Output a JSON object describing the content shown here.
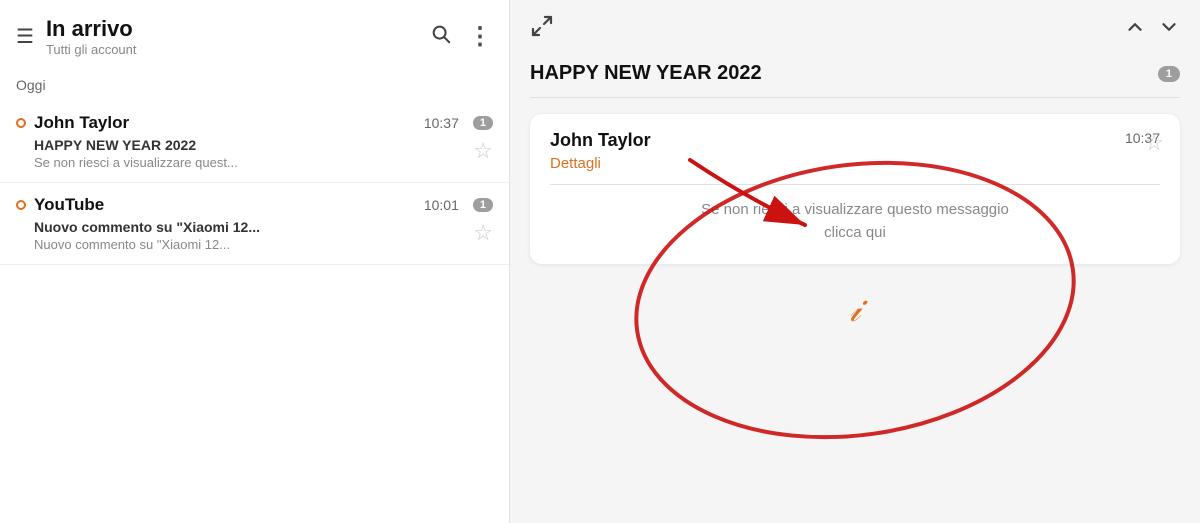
{
  "header": {
    "menu_icon": "☰",
    "title": "In arrivo",
    "subtitle": "Tutti gli account",
    "search_icon": "🔍",
    "more_icon": "⋮"
  },
  "section": {
    "today_label": "Oggi"
  },
  "emails": [
    {
      "sender": "John Taylor",
      "time": "10:37",
      "badge": "1",
      "subject": "HAPPY NEW YEAR 2022",
      "preview": "Se non riesci a visualizzare quest...",
      "unread": true
    },
    {
      "sender": "YouTube",
      "time": "10:01",
      "badge": "1",
      "subject_line1": "Nuovo commento su \"Xiaomi 12...",
      "subject_line2": "Nuovo commento su \"Xiaomi 12...",
      "unread": true
    }
  ],
  "right_panel": {
    "expand_icon": "↗",
    "nav_up": "∧",
    "nav_down": "∨",
    "email_subject": "HAPPY NEW YEAR 2022",
    "badge": "1",
    "card": {
      "sender": "John Taylor",
      "time": "10:37",
      "details_label": "Dettagli",
      "body_line1": "Se non riesci a visualizzare questo messaggio",
      "body_line2": "clicca qui"
    },
    "signature": "J"
  }
}
